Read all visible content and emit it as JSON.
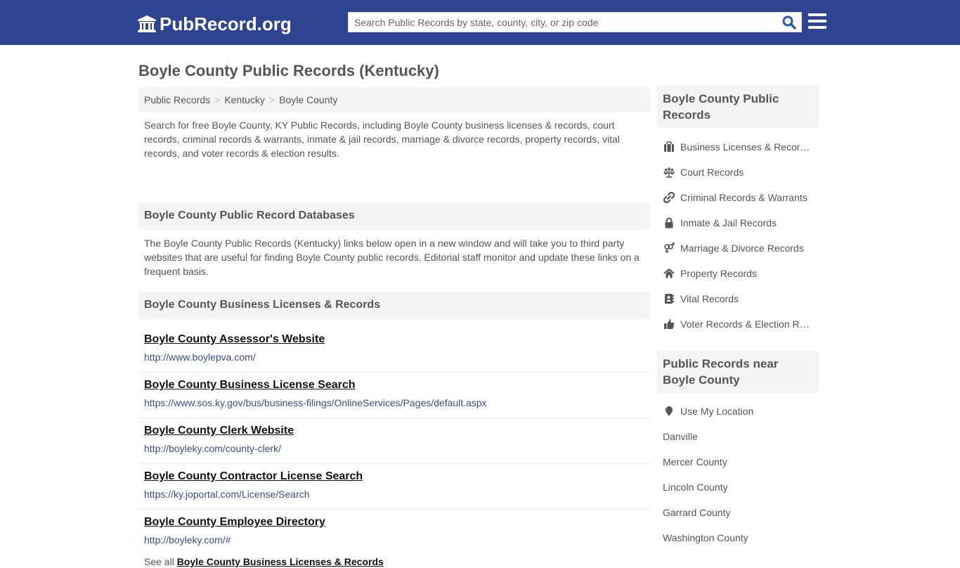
{
  "header": {
    "logo_text": "PubRecord.org",
    "search_placeholder": "Search Public Records by state, county, city, or zip code",
    "search_value": "",
    "brand_color": "#2e4490",
    "search_icon": "search-icon",
    "menu_icon": "hamburger-menu-icon"
  },
  "page": {
    "title": "Boyle County Public Records (Kentucky)"
  },
  "breadcrumb": [
    {
      "label": "Public Records"
    },
    {
      "label": "Kentucky"
    },
    {
      "label": "Boyle County"
    }
  ],
  "breadcrumb_separator": ">",
  "intro": "Search for free Boyle County, KY Public Records, including Boyle County business licenses & records, court records, criminal records & warrants, inmate & jail records, marriage & divorce records, property records, vital records, and voter records & election results.",
  "databases": {
    "heading": "Boyle County Public Record Databases",
    "text": "The Boyle County Public Records (Kentucky) links below open in a new window and will take you to third party websites that are useful for finding Boyle County public records. Editorial staff monitor and update these links on a frequent basis."
  },
  "business": {
    "heading": "Boyle County Business Licenses & Records",
    "links": [
      {
        "title": "Boyle County Assessor's Website",
        "url": "http://www.boylepva.com/"
      },
      {
        "title": "Boyle County Business License Search",
        "url": "https://www.sos.ky.gov/bus/business-filings/OnlineServices/Pages/default.aspx"
      },
      {
        "title": "Boyle County Clerk Website",
        "url": "http://boyleky.com/county-clerk/"
      },
      {
        "title": "Boyle County Contractor License Search",
        "url": "https://ky.joportal.com/License/Search"
      },
      {
        "title": "Boyle County Employee Directory",
        "url": "http://boyleky.com/#"
      }
    ],
    "see_all_prefix": "See all",
    "see_all_link": "Boyle County Business Licenses & Records"
  },
  "sidebar": {
    "records_heading": "Boyle County Public Records",
    "records": [
      {
        "label": "Business Licenses & Records",
        "icon": "briefcase-icon"
      },
      {
        "label": "Court Records",
        "icon": "balance-scale-icon"
      },
      {
        "label": "Criminal Records & Warrants",
        "icon": "link-icon"
      },
      {
        "label": "Inmate & Jail Records",
        "icon": "lock-icon"
      },
      {
        "label": "Marriage & Divorce Records",
        "icon": "venus-mars-icon"
      },
      {
        "label": "Property Records",
        "icon": "home-icon"
      },
      {
        "label": "Vital Records",
        "icon": "address-book-icon"
      },
      {
        "label": "Voter Records & Election Results",
        "icon": "thumbs-up-icon"
      }
    ],
    "near_heading": "Public Records near Boyle County",
    "use_location": {
      "label": "Use My Location",
      "icon": "map-marker-icon"
    },
    "near": [
      {
        "label": "Danville"
      },
      {
        "label": "Mercer County"
      },
      {
        "label": "Lincoln County"
      },
      {
        "label": "Garrard County"
      },
      {
        "label": "Washington County"
      }
    ]
  }
}
